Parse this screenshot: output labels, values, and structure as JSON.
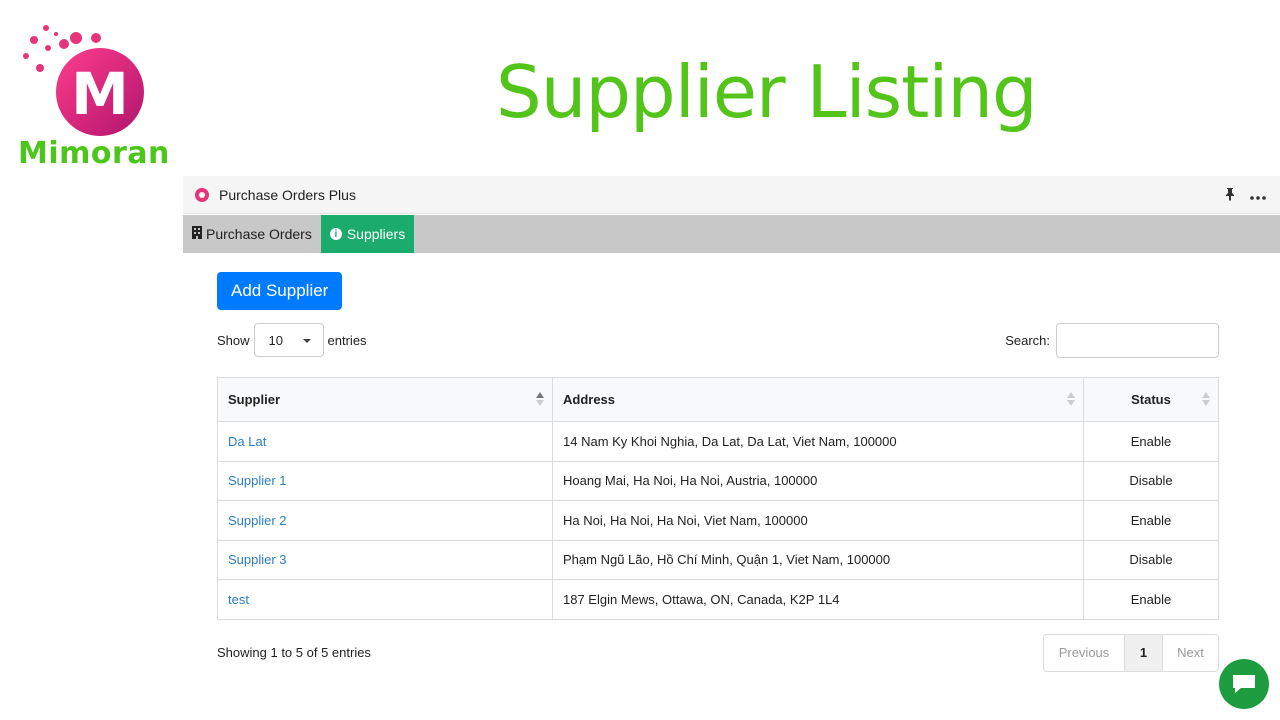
{
  "brand": {
    "name": "Mimoran",
    "color": "#4cc61a",
    "accent": "#e6357a"
  },
  "page": {
    "title": "Supplier Listing",
    "title_color": "#52c41a"
  },
  "app": {
    "title": "Purchase Orders Plus",
    "icons": {
      "pin": "pin-icon",
      "more": "more-icon"
    },
    "tabs": [
      {
        "label": "Purchase Orders",
        "icon": "building-icon",
        "active": false
      },
      {
        "label": "Suppliers",
        "icon": "info-icon",
        "active": true
      }
    ]
  },
  "toolbar": {
    "add_label": "Add Supplier"
  },
  "controls": {
    "show_label": "Show",
    "entries_value": "10",
    "entries_label": "entries",
    "search_label": "Search:",
    "search_value": ""
  },
  "table": {
    "columns": [
      "Supplier",
      "Address",
      "Status"
    ],
    "rows": [
      {
        "supplier": "Da Lat",
        "address": "14 Nam Ky Khoi Nghia, Da Lat, Da Lat, Viet Nam, 100000",
        "status": "Enable"
      },
      {
        "supplier": "Supplier 1",
        "address": "Hoang Mai, Ha Noi, Ha Noi, Austria, 100000",
        "status": "Disable"
      },
      {
        "supplier": "Supplier 2",
        "address": "Ha Noi, Ha Noi, Ha Noi, Viet Nam, 100000",
        "status": "Enable"
      },
      {
        "supplier": "Supplier 3",
        "address": "Phạm Ngũ Lão, Hồ Chí Minh, Quận 1, Viet Nam, 100000",
        "status": "Disable"
      },
      {
        "supplier": "test",
        "address": "187 Elgin Mews, Ottawa, ON, Canada, K2P 1L4",
        "status": "Enable"
      }
    ]
  },
  "footer": {
    "info": "Showing 1 to 5 of 5 entries",
    "previous": "Previous",
    "page": "1",
    "next": "Next"
  },
  "chat": {
    "icon": "chat-bubble-icon",
    "color": "#1e9d40"
  }
}
